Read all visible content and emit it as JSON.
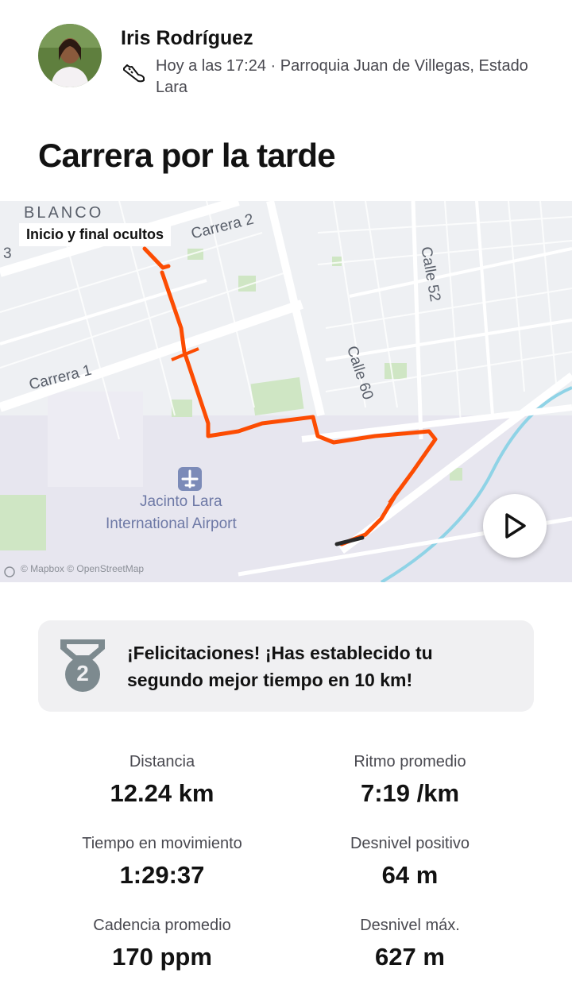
{
  "athlete": {
    "name": "Iris Rodríguez",
    "meta": "Hoy a las 17:24 · Parroquia Juan de Villegas, Estado Lara",
    "activity_icon": "running-shoe-icon"
  },
  "activity": {
    "title": "Carrera por la tarde"
  },
  "map": {
    "privacy_tag": "Inicio y final ocultos",
    "labels": {
      "district": "BLANCO",
      "carrera2": "Carrera 2",
      "carrera1": "Carrera 1",
      "calle52": "Calle 52",
      "calle60": "Calle 60",
      "airport_line1": "Jacinto Lara",
      "airport_line2": "International Airport",
      "edge_number": "3"
    },
    "attribution": "© Mapbox © OpenStreetMap",
    "route_color": "#fc4c02",
    "play_icon": "play-icon"
  },
  "achievement": {
    "rank": "2",
    "message": "¡Felicitaciones! ¡Has establecido tu segundo mejor tiempo en 10 km!",
    "medal_color": "#7d8a8f"
  },
  "stats": [
    {
      "label": "Distancia",
      "value": "12.24 km"
    },
    {
      "label": "Ritmo promedio",
      "value": "7:19 /km"
    },
    {
      "label": "Tiempo en movimiento",
      "value": "1:29:37"
    },
    {
      "label": "Desnivel positivo",
      "value": "64 m"
    },
    {
      "label": "Cadencia promedio",
      "value": "170 ppm"
    },
    {
      "label": "Desnivel máx.",
      "value": "627 m"
    }
  ]
}
